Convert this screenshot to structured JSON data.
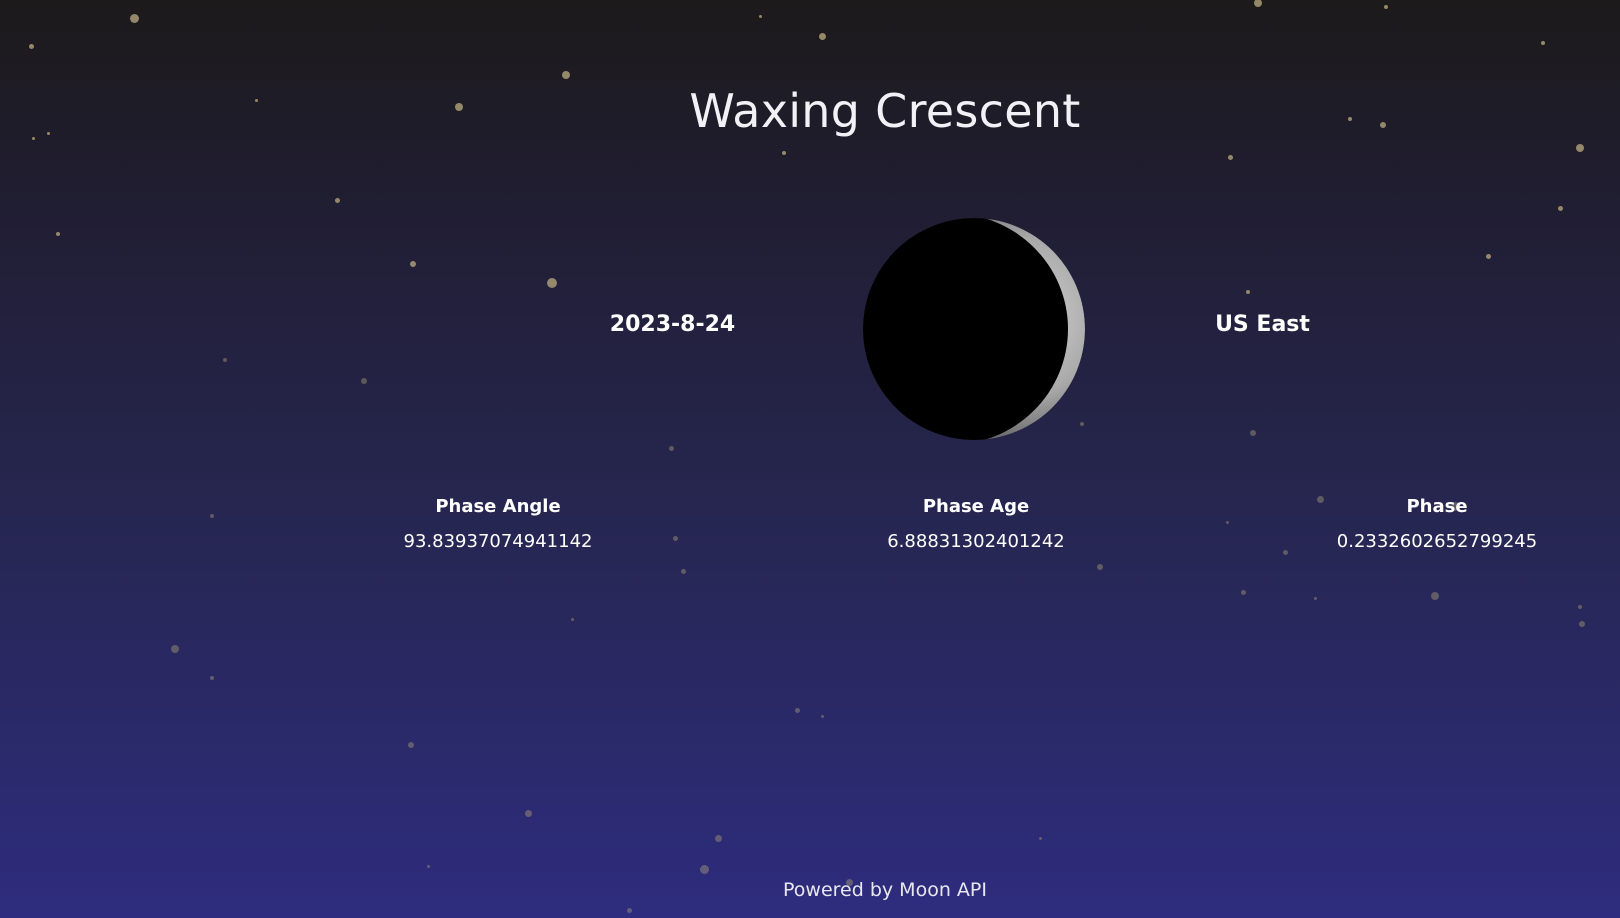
{
  "header": {
    "phase_name": "Waxing Crescent"
  },
  "moon": {
    "icon": "moon-crescent-icon"
  },
  "info": {
    "date": "2023-8-24",
    "location": "US East"
  },
  "stats": {
    "phase_angle": {
      "label": "Phase Angle",
      "value": "93.83937074941142"
    },
    "phase_age": {
      "label": "Phase Age",
      "value": "6.88831302401242"
    },
    "phase": {
      "label": "Phase",
      "value": "0.2332602652799245"
    }
  },
  "footer": {
    "credit": "Powered by Moon API"
  },
  "colors": {
    "background_top": "#1c1a1a",
    "background_bottom": "#2e2c7e",
    "text": "#ffffff",
    "star": "#a99b77"
  }
}
